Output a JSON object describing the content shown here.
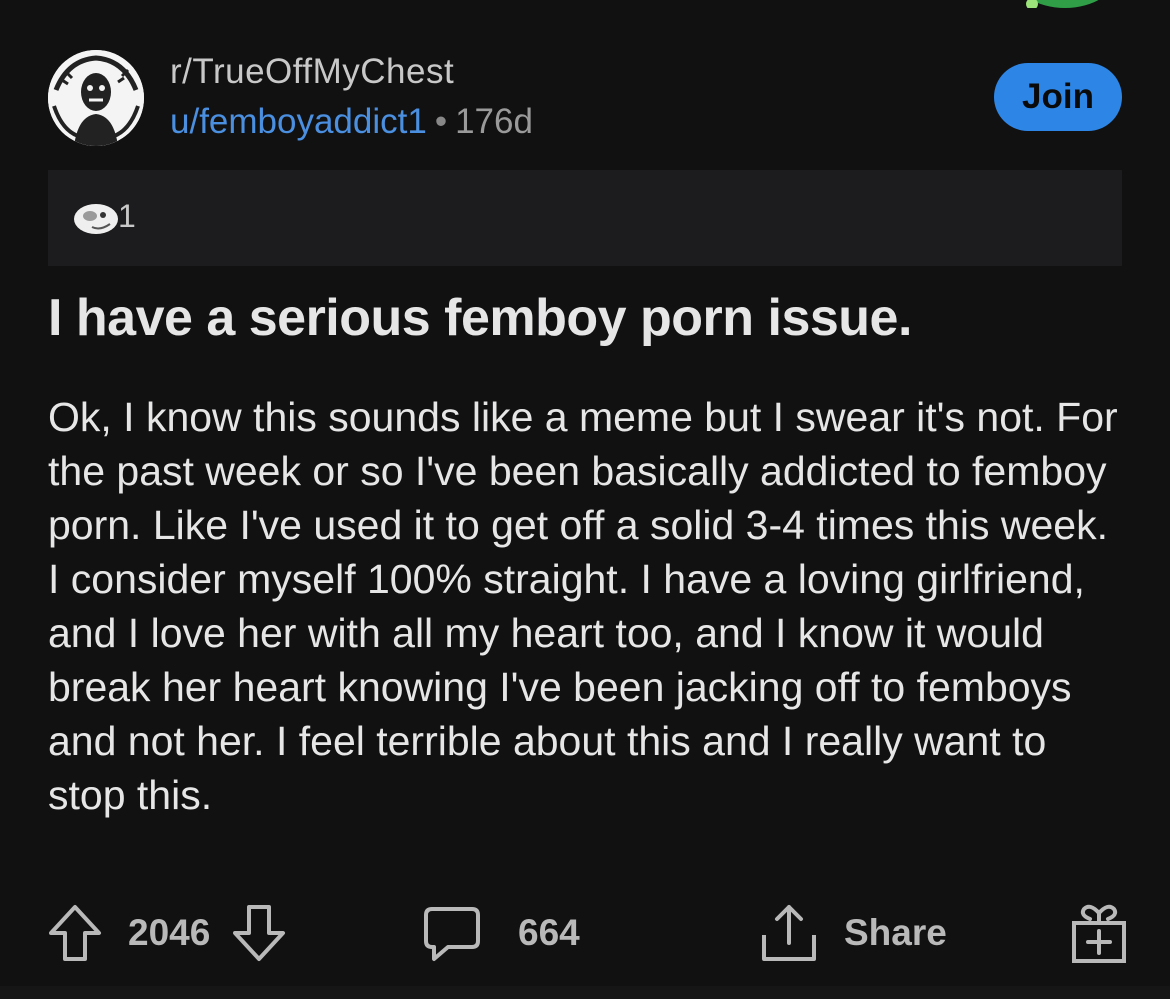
{
  "post": {
    "subreddit": "r/TrueOffMyChest",
    "username": "u/femboyaddict1",
    "separator": "•",
    "age": "176d",
    "join_label": "Join",
    "award_count": "1",
    "title": "I have a serious femboy porn issue.",
    "body": "Ok, I know this sounds like a meme but I swear it's not. For the past week or so I've been basically addicted to femboy porn. Like I've used it to get off a solid 3-4 times this week. I consider myself 100% straight. I have a loving girlfriend, and I love her with all my heart too, and I know it would break her heart knowing I've been jacking off to femboys and not her. I feel terrible about this and I really want to stop this."
  },
  "actions": {
    "vote_count": "2046",
    "comment_count": "664",
    "share_label": "Share"
  },
  "colors": {
    "background": "#111112",
    "accent": "#2d86e6",
    "username": "#4a8fe0",
    "text": "#e6e6e6"
  },
  "icons": [
    "upvote-icon",
    "downvote-icon",
    "comment-icon",
    "share-icon",
    "gift-icon",
    "award-icon"
  ]
}
